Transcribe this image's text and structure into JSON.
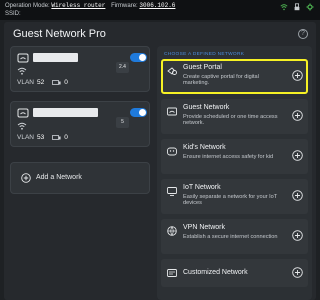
{
  "statusbar": {
    "operation_mode_label": "Operation Mode:",
    "operation_mode_value": "Wireless router",
    "firmware_label": "Firmware:",
    "firmware_value": "3006.102.6",
    "ssid_label": "SSID:",
    "icons": [
      "wifi-status-icon",
      "usb-icon",
      "settings-status-icon"
    ],
    "icon_color": "#4caf50"
  },
  "page": {
    "title": "Guest Network Pro",
    "help_icon": "?"
  },
  "networks": [
    {
      "vlan_label": "VLAN",
      "vlan": "52",
      "devices": "0",
      "toggle_on": true,
      "band_badge": "2.4"
    },
    {
      "vlan_label": "VLAN",
      "vlan": "53",
      "devices": "0",
      "toggle_on": true,
      "band_badge": "5"
    }
  ],
  "add_network": {
    "label": "Add a Network"
  },
  "options": {
    "caption": "CHOOSE A DEFINED NETWORK",
    "items": [
      {
        "title": "Guest Portal",
        "desc": "Create captive portal for digital marketing.",
        "icon": "portal-icon",
        "selected": true
      },
      {
        "title": "Guest Network",
        "desc": "Provide scheduled or one time access network.",
        "icon": "guest-network-icon",
        "selected": false
      },
      {
        "title": "Kid's Network",
        "desc": "Ensure internet access safety for kid",
        "icon": "kids-network-icon",
        "selected": false
      },
      {
        "title": "IoT Network",
        "desc": "Easily separate a network for your IoT devices",
        "icon": "iot-network-icon",
        "selected": false
      },
      {
        "title": "VPN Network",
        "desc": "Establish a secure internet connection",
        "icon": "vpn-network-icon",
        "selected": false
      },
      {
        "title": "Customized Network",
        "desc": "",
        "icon": "customized-network-icon",
        "selected": false
      }
    ]
  },
  "colors": {
    "accent": "#1f7adb",
    "highlight": "#f6f125",
    "caption": "#4a8ee0"
  }
}
